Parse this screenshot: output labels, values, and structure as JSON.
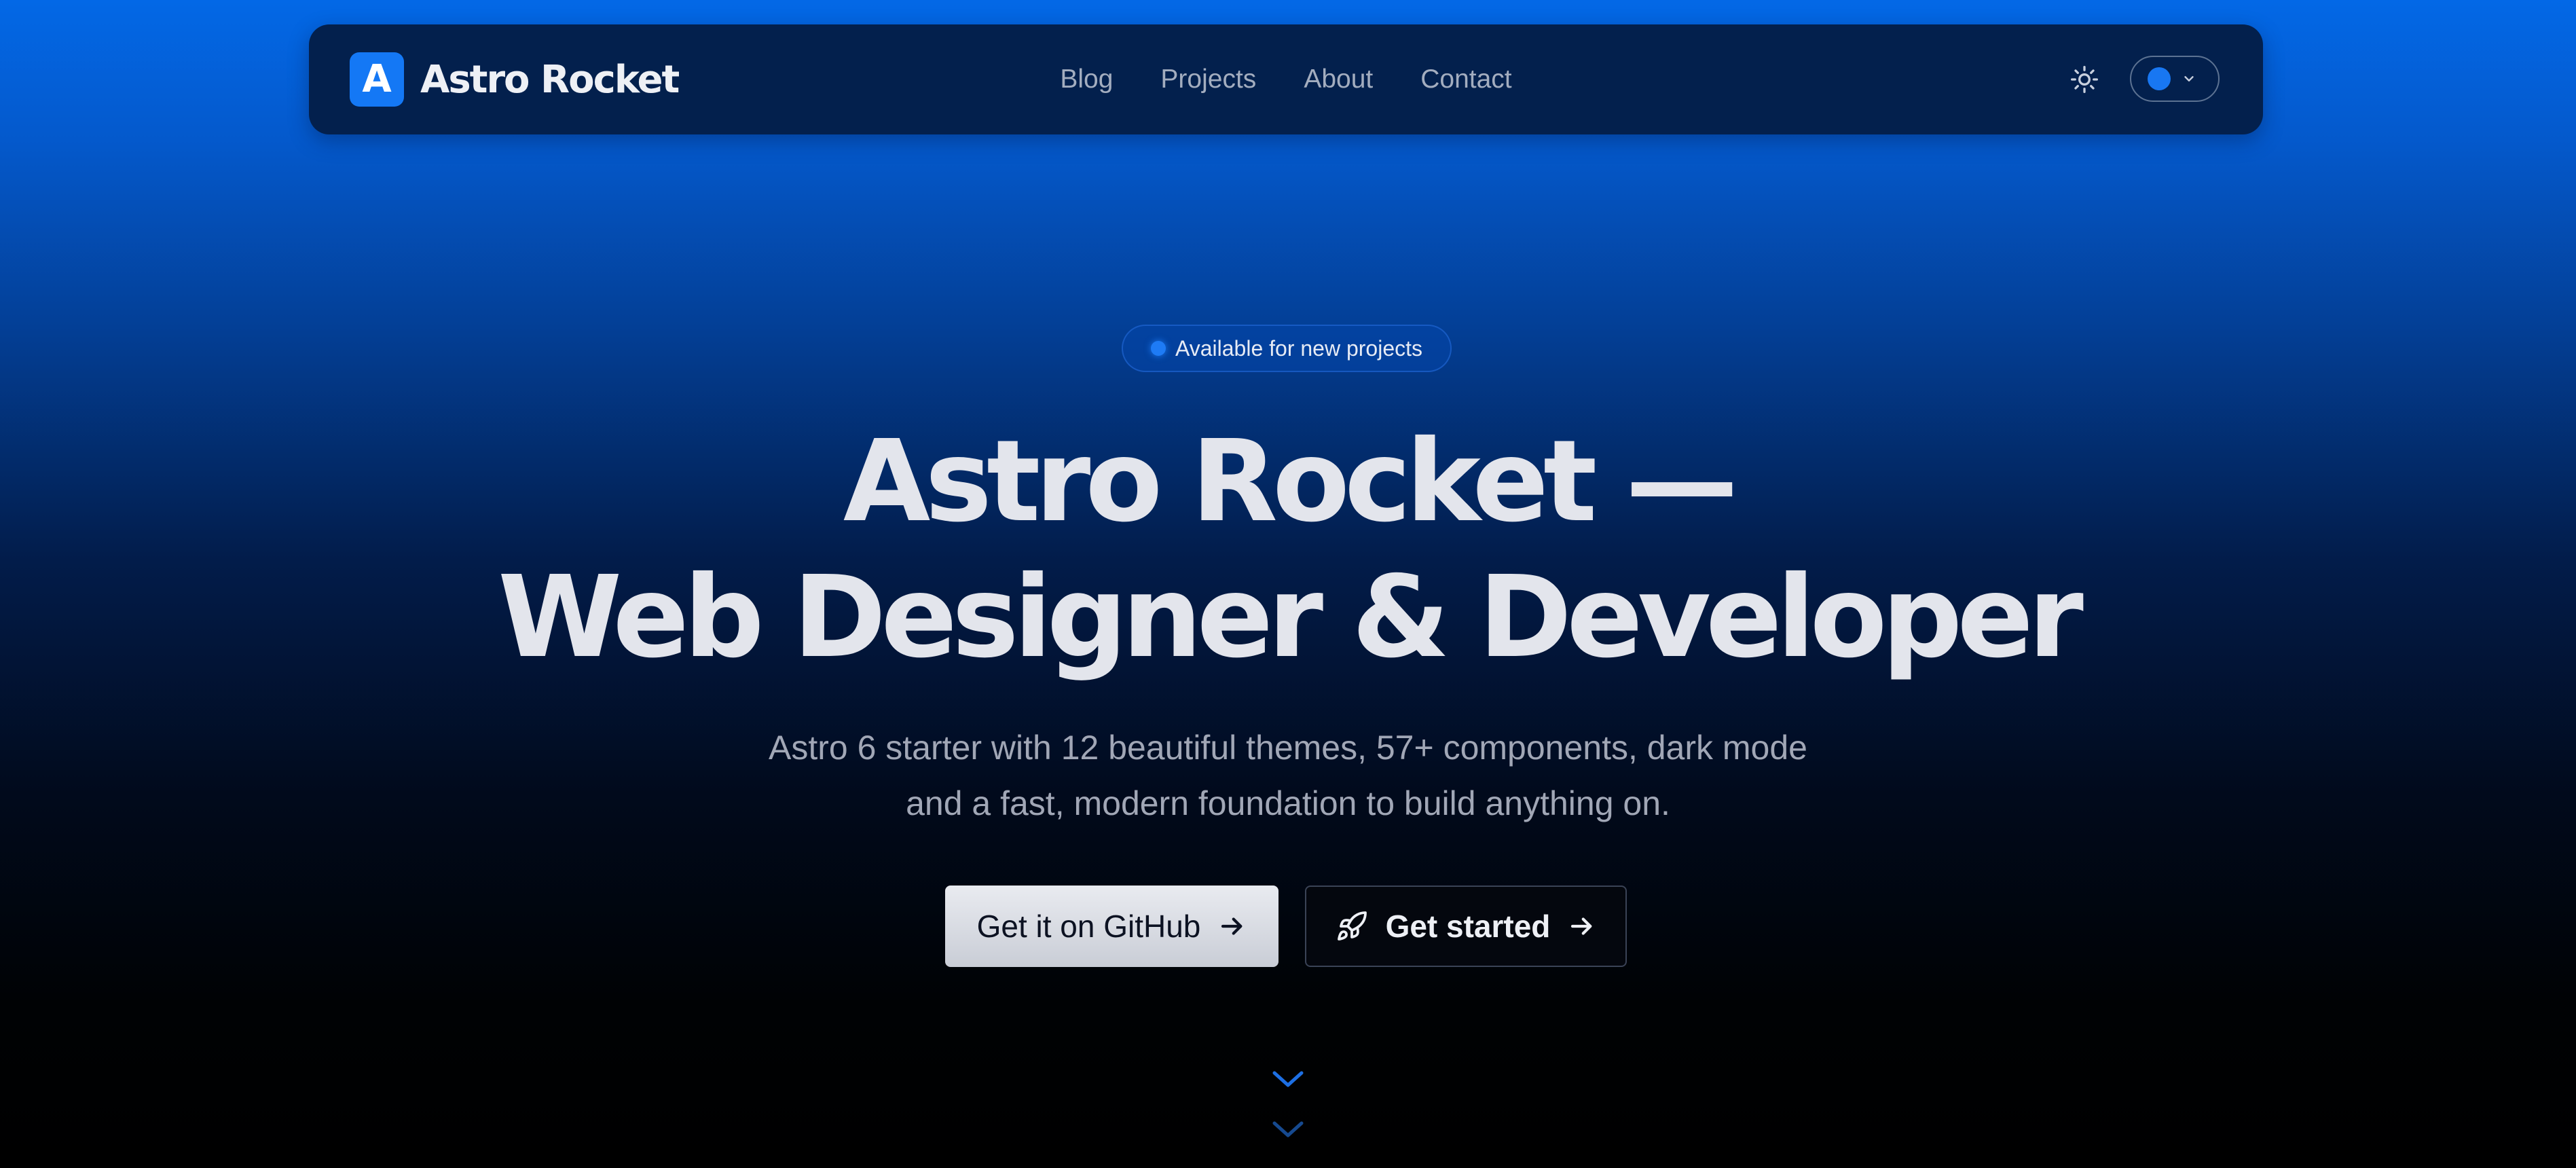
{
  "header": {
    "brand": {
      "mark": "A",
      "name": "Astro Rocket"
    },
    "nav": [
      {
        "label": "Blog"
      },
      {
        "label": "Projects"
      },
      {
        "label": "About"
      },
      {
        "label": "Contact"
      }
    ],
    "theme_toggle_icon": "sun-icon",
    "color_picker": {
      "icon": "chevron-down-icon",
      "selected_color": "#1877f2"
    }
  },
  "hero": {
    "badge": {
      "text": "Available for new projects",
      "dot_color": "#1e7bf5"
    },
    "title_line1": "Astro Rocket —",
    "title_line2": "Web Designer & Developer",
    "subtitle": "Astro 6 starter with 12 beautiful themes, 57+ components, dark mode and a fast, modern foundation to build anything on.",
    "primary_button": {
      "label": "Get it on GitHub",
      "icon": "arrow-right-icon"
    },
    "secondary_button": {
      "label": "Get started",
      "icon": "rocket-icon",
      "trailing_icon": "arrow-right-icon"
    },
    "scroll_icon": "double-chevron-down-icon"
  },
  "colors": {
    "accent": "#1478f5",
    "nav_bg": "#03204d",
    "text_primary": "#e3e5ec",
    "text_muted": "#a1a7b6"
  }
}
